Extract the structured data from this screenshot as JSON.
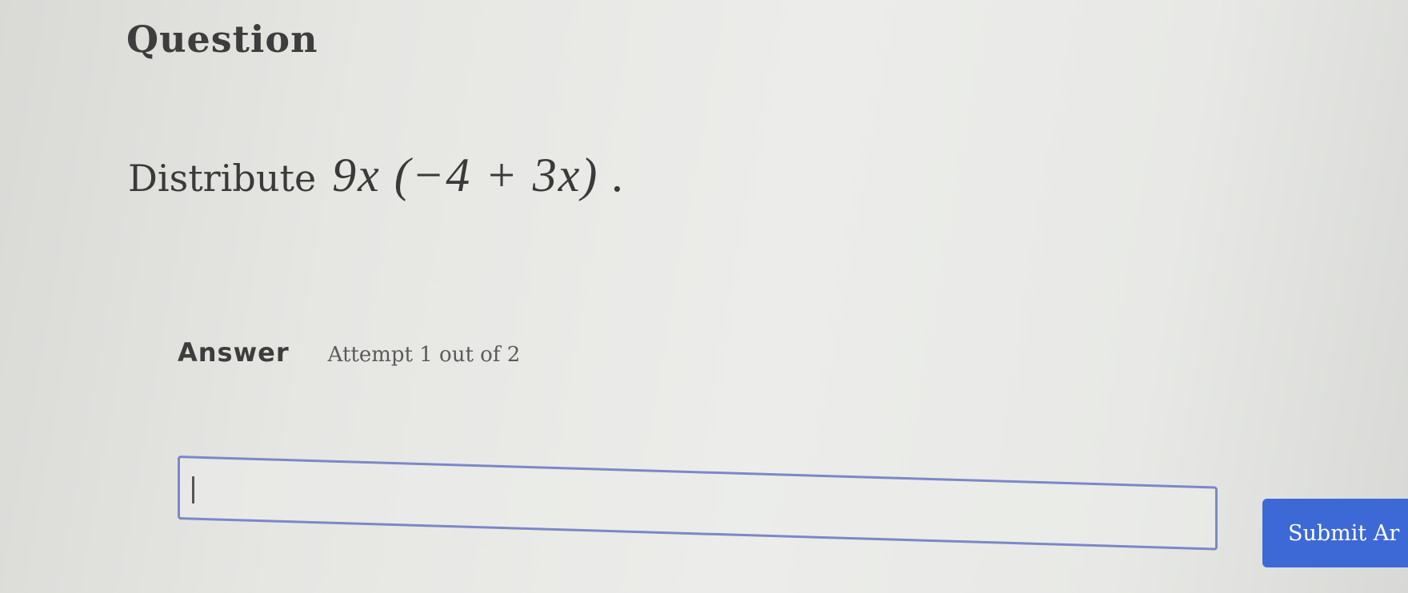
{
  "question": {
    "heading": "Question",
    "instruction": "Distribute",
    "expression": "9x (−4 + 3x) ."
  },
  "answer": {
    "label": "Answer",
    "attempt_text": "Attempt 1 out of 2",
    "input_value": "",
    "submit_label": "Submit Ar"
  },
  "colors": {
    "submit_button": "#3d69d6",
    "input_border": "#7b88c7"
  }
}
